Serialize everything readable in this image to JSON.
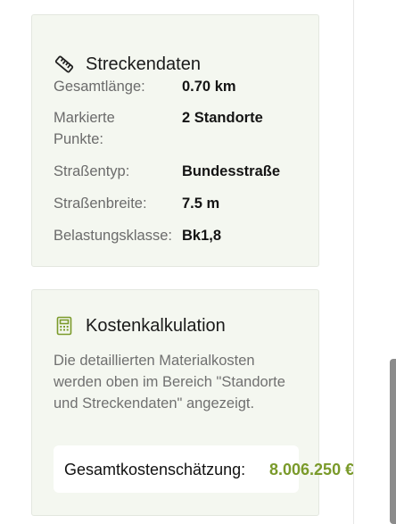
{
  "route_card": {
    "title": "Streckendaten",
    "icon": "ruler-icon",
    "rows": [
      {
        "label": "Gesamtlänge:",
        "value": "0.70 km"
      },
      {
        "label": "Markierte Punkte:",
        "value": "2 Standorte"
      },
      {
        "label": "Straßentyp:",
        "value": "Bundesstraße"
      },
      {
        "label": "Straßenbreite:",
        "value": "7.5 m"
      },
      {
        "label": "Belastungsklasse:",
        "value": "Bk1,8"
      }
    ]
  },
  "cost_card": {
    "title": "Kostenkalkulation",
    "icon": "calculator-icon",
    "description": "Die detaillierten Materialkosten werden oben im Bereich \"Standorte und Streckendaten\" angezeigt.",
    "total_label": "Gesamtkostenschätzung:",
    "total_value": "8.006.250 €"
  },
  "colors": {
    "card_background": "#f4f7f0",
    "accent_green": "#7a9a2a"
  }
}
